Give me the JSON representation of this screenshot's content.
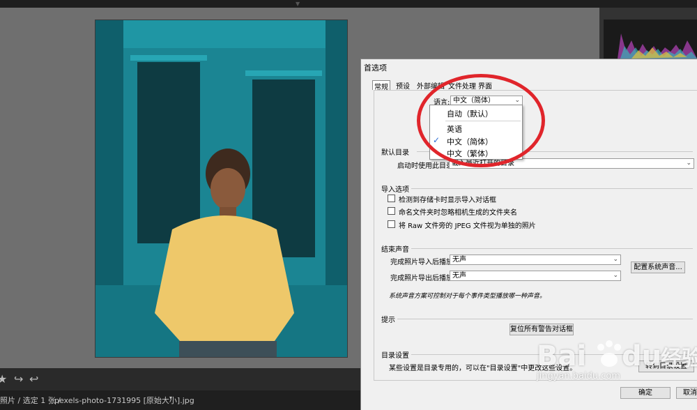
{
  "lightroom": {
    "filmstrip_status": "照片 / 选定 1 张 /",
    "filmstrip_file": "pexels-photo-1731995 [原始大小].jpg",
    "filmstrip_caret": "▾"
  },
  "dialog": {
    "title": "首选项",
    "tabs": [
      "常规",
      "预设",
      "外部编辑",
      "文件处理",
      "界面"
    ],
    "language_label": "语言:",
    "language_value": "中文（简体）",
    "language_options": [
      "自动（默认）",
      "英语",
      "中文（简体）",
      "中文（繁体）"
    ],
    "language_selected_index": 2,
    "default_catalog": {
      "title": "默认目录",
      "label": "启动时使用此目录:",
      "value": "载入最近打开的目录"
    },
    "import_options": {
      "title": "导入选项",
      "items": [
        "检测到存储卡时显示导入对话框",
        "命名文件夹时忽略相机生成的文件夹名",
        "将 Raw 文件旁的 JPEG 文件视为单独的照片"
      ]
    },
    "completion_sounds": {
      "title": "结束声音",
      "import_label": "完成照片导入后播放:",
      "import_value": "无声",
      "export_label": "完成照片导出后播放:",
      "export_value": "无声",
      "config_button": "配置系统声音...",
      "note": "系统声音方案可控制对于每个事件类型播放哪一种声音。"
    },
    "prompts": {
      "title": "提示",
      "reset_button": "复位所有警告对话框"
    },
    "catalog_settings": {
      "title": "目录设置",
      "text": "某些设置是目录专用的，可以在\"目录设置\"中更改这些设置。",
      "button": "转到目录设置"
    },
    "ok_button": "确定",
    "cancel_button": "取消"
  },
  "watermark": {
    "logo": "Bai du 经验",
    "url": "jingyan.baidu.com"
  },
  "colors": {
    "annotation_red": "#e0252b",
    "check_blue": "#2b6cd4"
  }
}
